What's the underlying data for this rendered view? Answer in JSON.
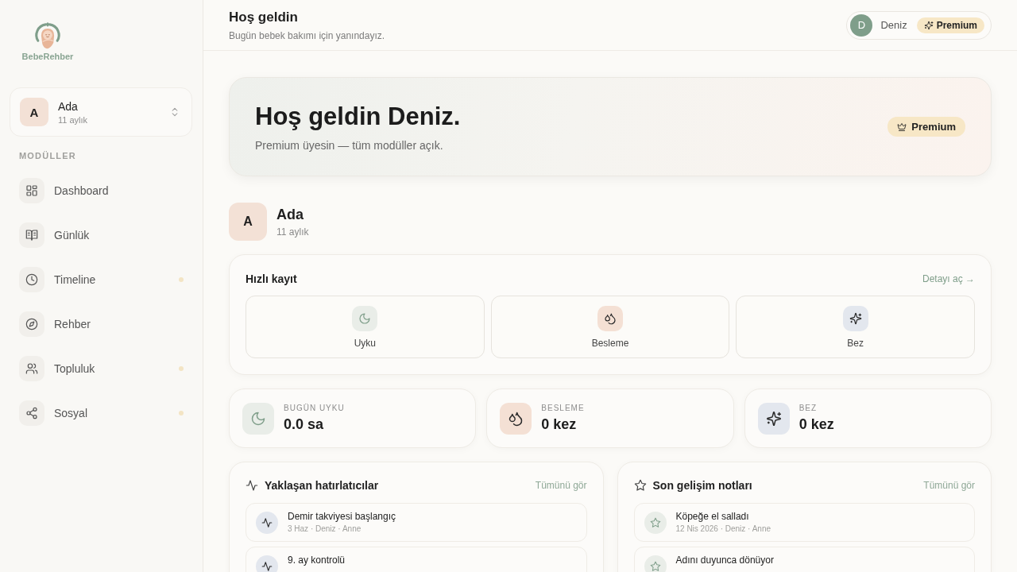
{
  "sidebar": {
    "logo": {
      "text": "BebeRehber"
    },
    "child_switcher": {
      "initial": "A",
      "name": "Ada",
      "age": "11 aylık"
    },
    "section_label": "MODÜLLER",
    "items": [
      {
        "label": "Dashboard",
        "dot": false
      },
      {
        "label": "Günlük",
        "dot": false
      },
      {
        "label": "Timeline",
        "dot": true
      },
      {
        "label": "Rehber",
        "dot": false
      },
      {
        "label": "Topluluk",
        "dot": true
      },
      {
        "label": "Sosyal",
        "dot": true
      }
    ]
  },
  "header": {
    "title": "Hoş geldin",
    "subtitle": "Bugün bebek bakımı için yanındayız.",
    "user": {
      "initial": "D",
      "name": "Deniz",
      "badge": "Premium"
    }
  },
  "hero": {
    "title": "Hoş geldin Deniz.",
    "subtitle": "Premium üyesin — tüm modüller açık.",
    "badge": "Premium"
  },
  "child": {
    "initial": "A",
    "name": "Ada",
    "age": "11 aylık"
  },
  "quick_log": {
    "title": "Hızlı kayıt",
    "link": "Detayı aç →",
    "buttons": [
      {
        "kind": "sleep",
        "label": "Uyku"
      },
      {
        "kind": "feeding",
        "label": "Besleme"
      },
      {
        "kind": "diaper",
        "label": "Bez"
      }
    ]
  },
  "stats": [
    {
      "kind": "sleep",
      "label": "BUGÜN UYKU",
      "value": "0.0 sa"
    },
    {
      "kind": "feeding",
      "label": "BESLEME",
      "value": "0 kez"
    },
    {
      "kind": "diaper",
      "label": "BEZ",
      "value": "0 kez"
    }
  ],
  "reminders": {
    "title": "Yaklaşan hatırlatıcılar",
    "link": "Tümünü gör",
    "items": [
      {
        "title": "Demir takviyesi başlangıç",
        "meta": "3 Haz · Deniz · Anne"
      },
      {
        "title": "9. ay kontrolü"
      }
    ]
  },
  "notes": {
    "title": "Son gelişim notları",
    "link": "Tümünü gör",
    "items": [
      {
        "title": "Köpeğe el salladı",
        "meta": "12 Nis 2026 · Deniz · Anne"
      },
      {
        "title": "Adını duyunca dönüyor"
      }
    ]
  }
}
